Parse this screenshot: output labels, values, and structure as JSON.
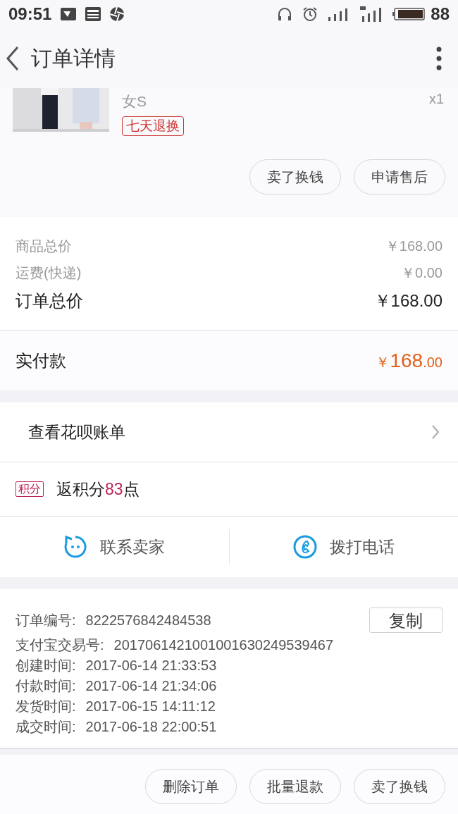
{
  "status_bar": {
    "time": "09:51",
    "battery": "88"
  },
  "header": {
    "title": "订单详情"
  },
  "product": {
    "spec": "女S",
    "quantity": "x1",
    "tag": "七天退换",
    "buttons": [
      "卖了换钱",
      "申请售后"
    ]
  },
  "prices": [
    {
      "label": "商品总价",
      "value": "￥168.00",
      "kind": "minor"
    },
    {
      "label": "运费(快递)",
      "value": "￥0.00",
      "kind": "minor"
    },
    {
      "label": "订单总价",
      "value": "￥168.00",
      "kind": "major"
    }
  ],
  "paid": {
    "label": "实付款",
    "currency": "￥",
    "integer": "168",
    "decimal": ".00"
  },
  "huabei": {
    "label": "查看花呗账单"
  },
  "points": {
    "badge": "积分",
    "prefix": "返积分",
    "amount": "83",
    "suffix": "点"
  },
  "contacts": [
    {
      "label": "联系卖家",
      "kind": "chat"
    },
    {
      "label": "拨打电话",
      "kind": "phone"
    }
  ],
  "info": {
    "copy_button": "复制",
    "rows": [
      {
        "label": "订单编号:",
        "value": "8222576842484538"
      },
      {
        "label": "支付宝交易号:",
        "value": "2017061421001001630249539467"
      },
      {
        "label": "创建时间:",
        "value": "2017-06-14 21:33:53"
      },
      {
        "label": "付款时间:",
        "value": "2017-06-14 21:34:06"
      },
      {
        "label": "发货时间:",
        "value": "2017-06-15 14:11:12"
      },
      {
        "label": "成交时间:",
        "value": "2017-06-18 22:00:51"
      }
    ]
  },
  "bottom_buttons": [
    "删除订单",
    "批量退款",
    "卖了换钱"
  ]
}
